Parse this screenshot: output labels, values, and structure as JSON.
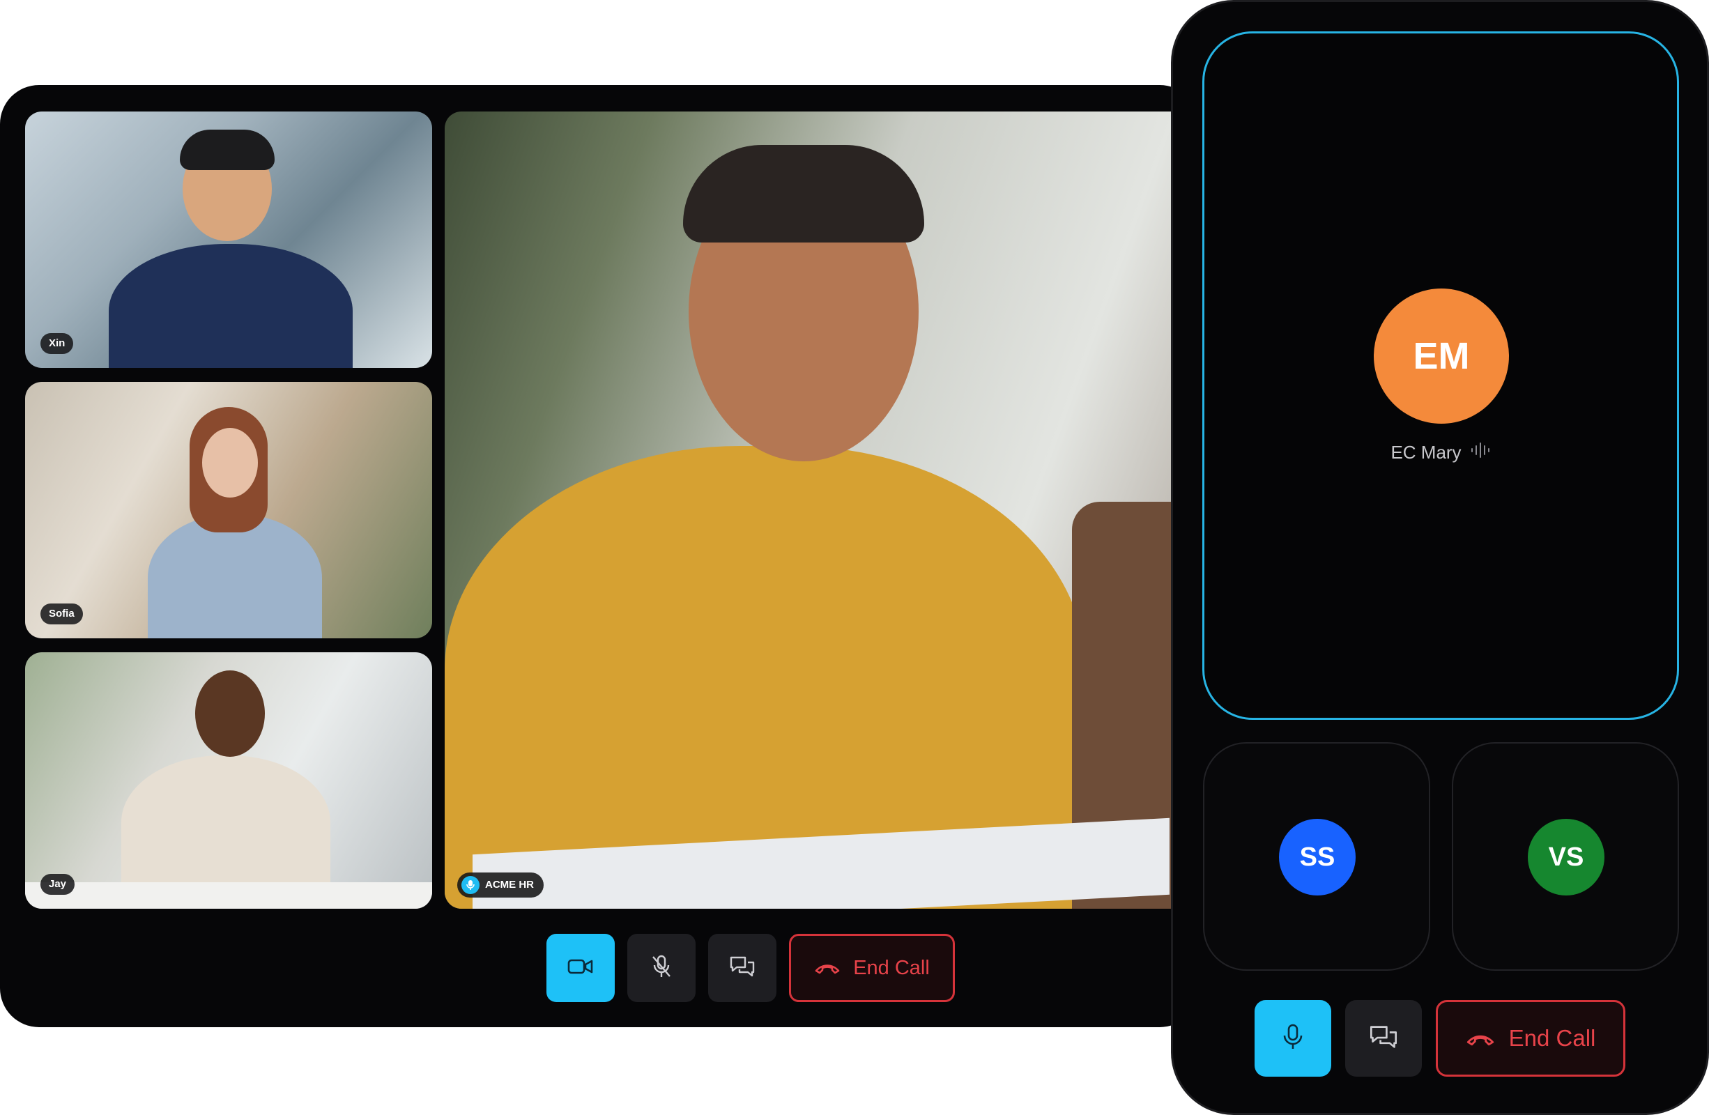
{
  "desktop": {
    "participants": [
      {
        "name": "Xin"
      },
      {
        "name": "Sofia"
      },
      {
        "name": "Jay"
      }
    ],
    "main_speaker": {
      "name": "ACME HR"
    },
    "controls": {
      "camera_icon": "video-camera-icon",
      "mic_icon": "microphone-off-icon",
      "chat_icon": "chat-bubbles-icon",
      "end_call_label": "End Call"
    }
  },
  "mobile": {
    "active_speaker": {
      "initials": "EM",
      "name": "EC Mary",
      "color": "#f48a3b"
    },
    "participants": [
      {
        "initials": "SS",
        "color": "#1862ff"
      },
      {
        "initials": "VS",
        "color": "#16872f"
      }
    ],
    "controls": {
      "mic_icon": "microphone-icon",
      "chat_icon": "chat-bubbles-icon",
      "end_call_label": "End Call"
    }
  },
  "colors": {
    "accent": "#1ec1f7",
    "danger": "#e8434a",
    "speaker_border": "#27b4e4"
  }
}
